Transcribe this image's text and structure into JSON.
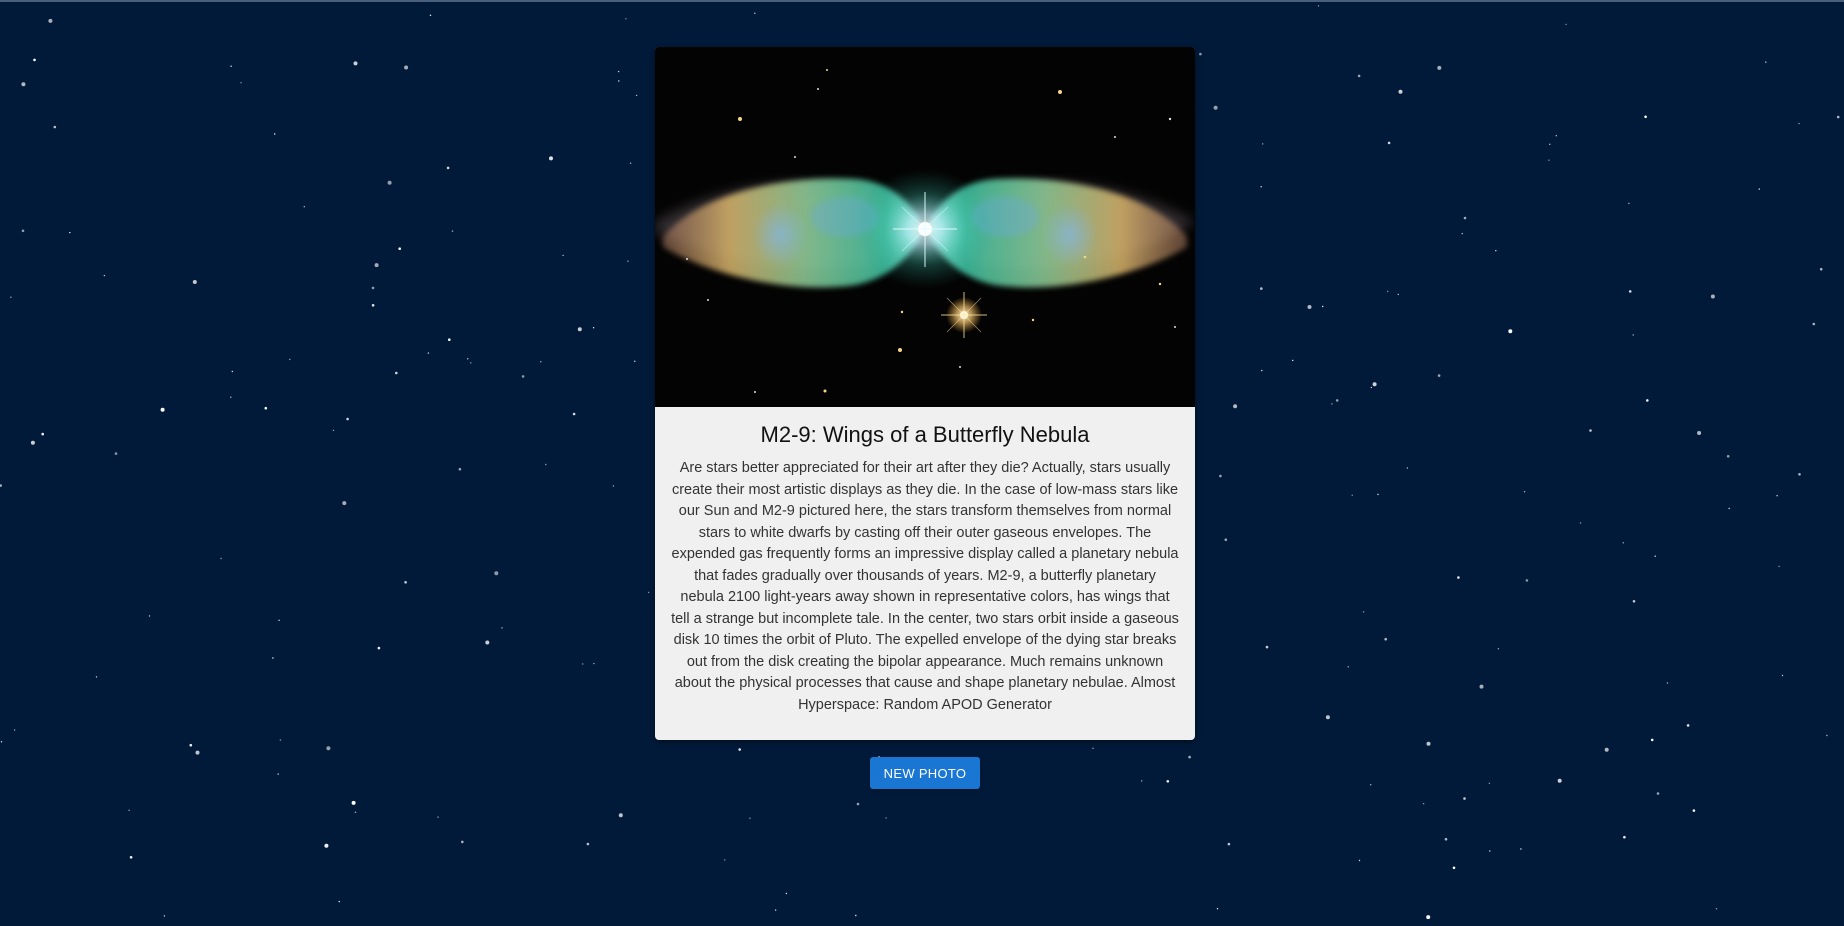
{
  "colors": {
    "background": "#021a39",
    "card": "#f0f0f0",
    "button": "#1976d2"
  },
  "apod": {
    "title": "M2-9: Wings of a Butterfly Nebula",
    "image_subject": "butterfly-planetary-nebula-photo",
    "explanation": "Are stars better appreciated for their art after they die? Actually, stars usually create their most artistic displays as they die. In the case of low-mass stars like our Sun and M2-9 pictured here, the stars transform themselves from normal stars to white dwarfs by casting off their outer gaseous envelopes. The expended gas frequently forms an impressive display called a planetary nebula that fades gradually over thousands of years. M2-9, a butterfly planetary nebula 2100 light-years away shown in representative colors, has wings that tell a strange but incomplete tale. In the center, two stars orbit inside a gaseous disk 10 times the orbit of Pluto. The expelled envelope of the dying star breaks out from the disk creating the bipolar appearance. Much remains unknown about the physical processes that cause and shape planetary nebulae. Almost Hyperspace: Random APOD Generator"
  },
  "controls": {
    "new_photo_label": "NEW PHOTO"
  }
}
